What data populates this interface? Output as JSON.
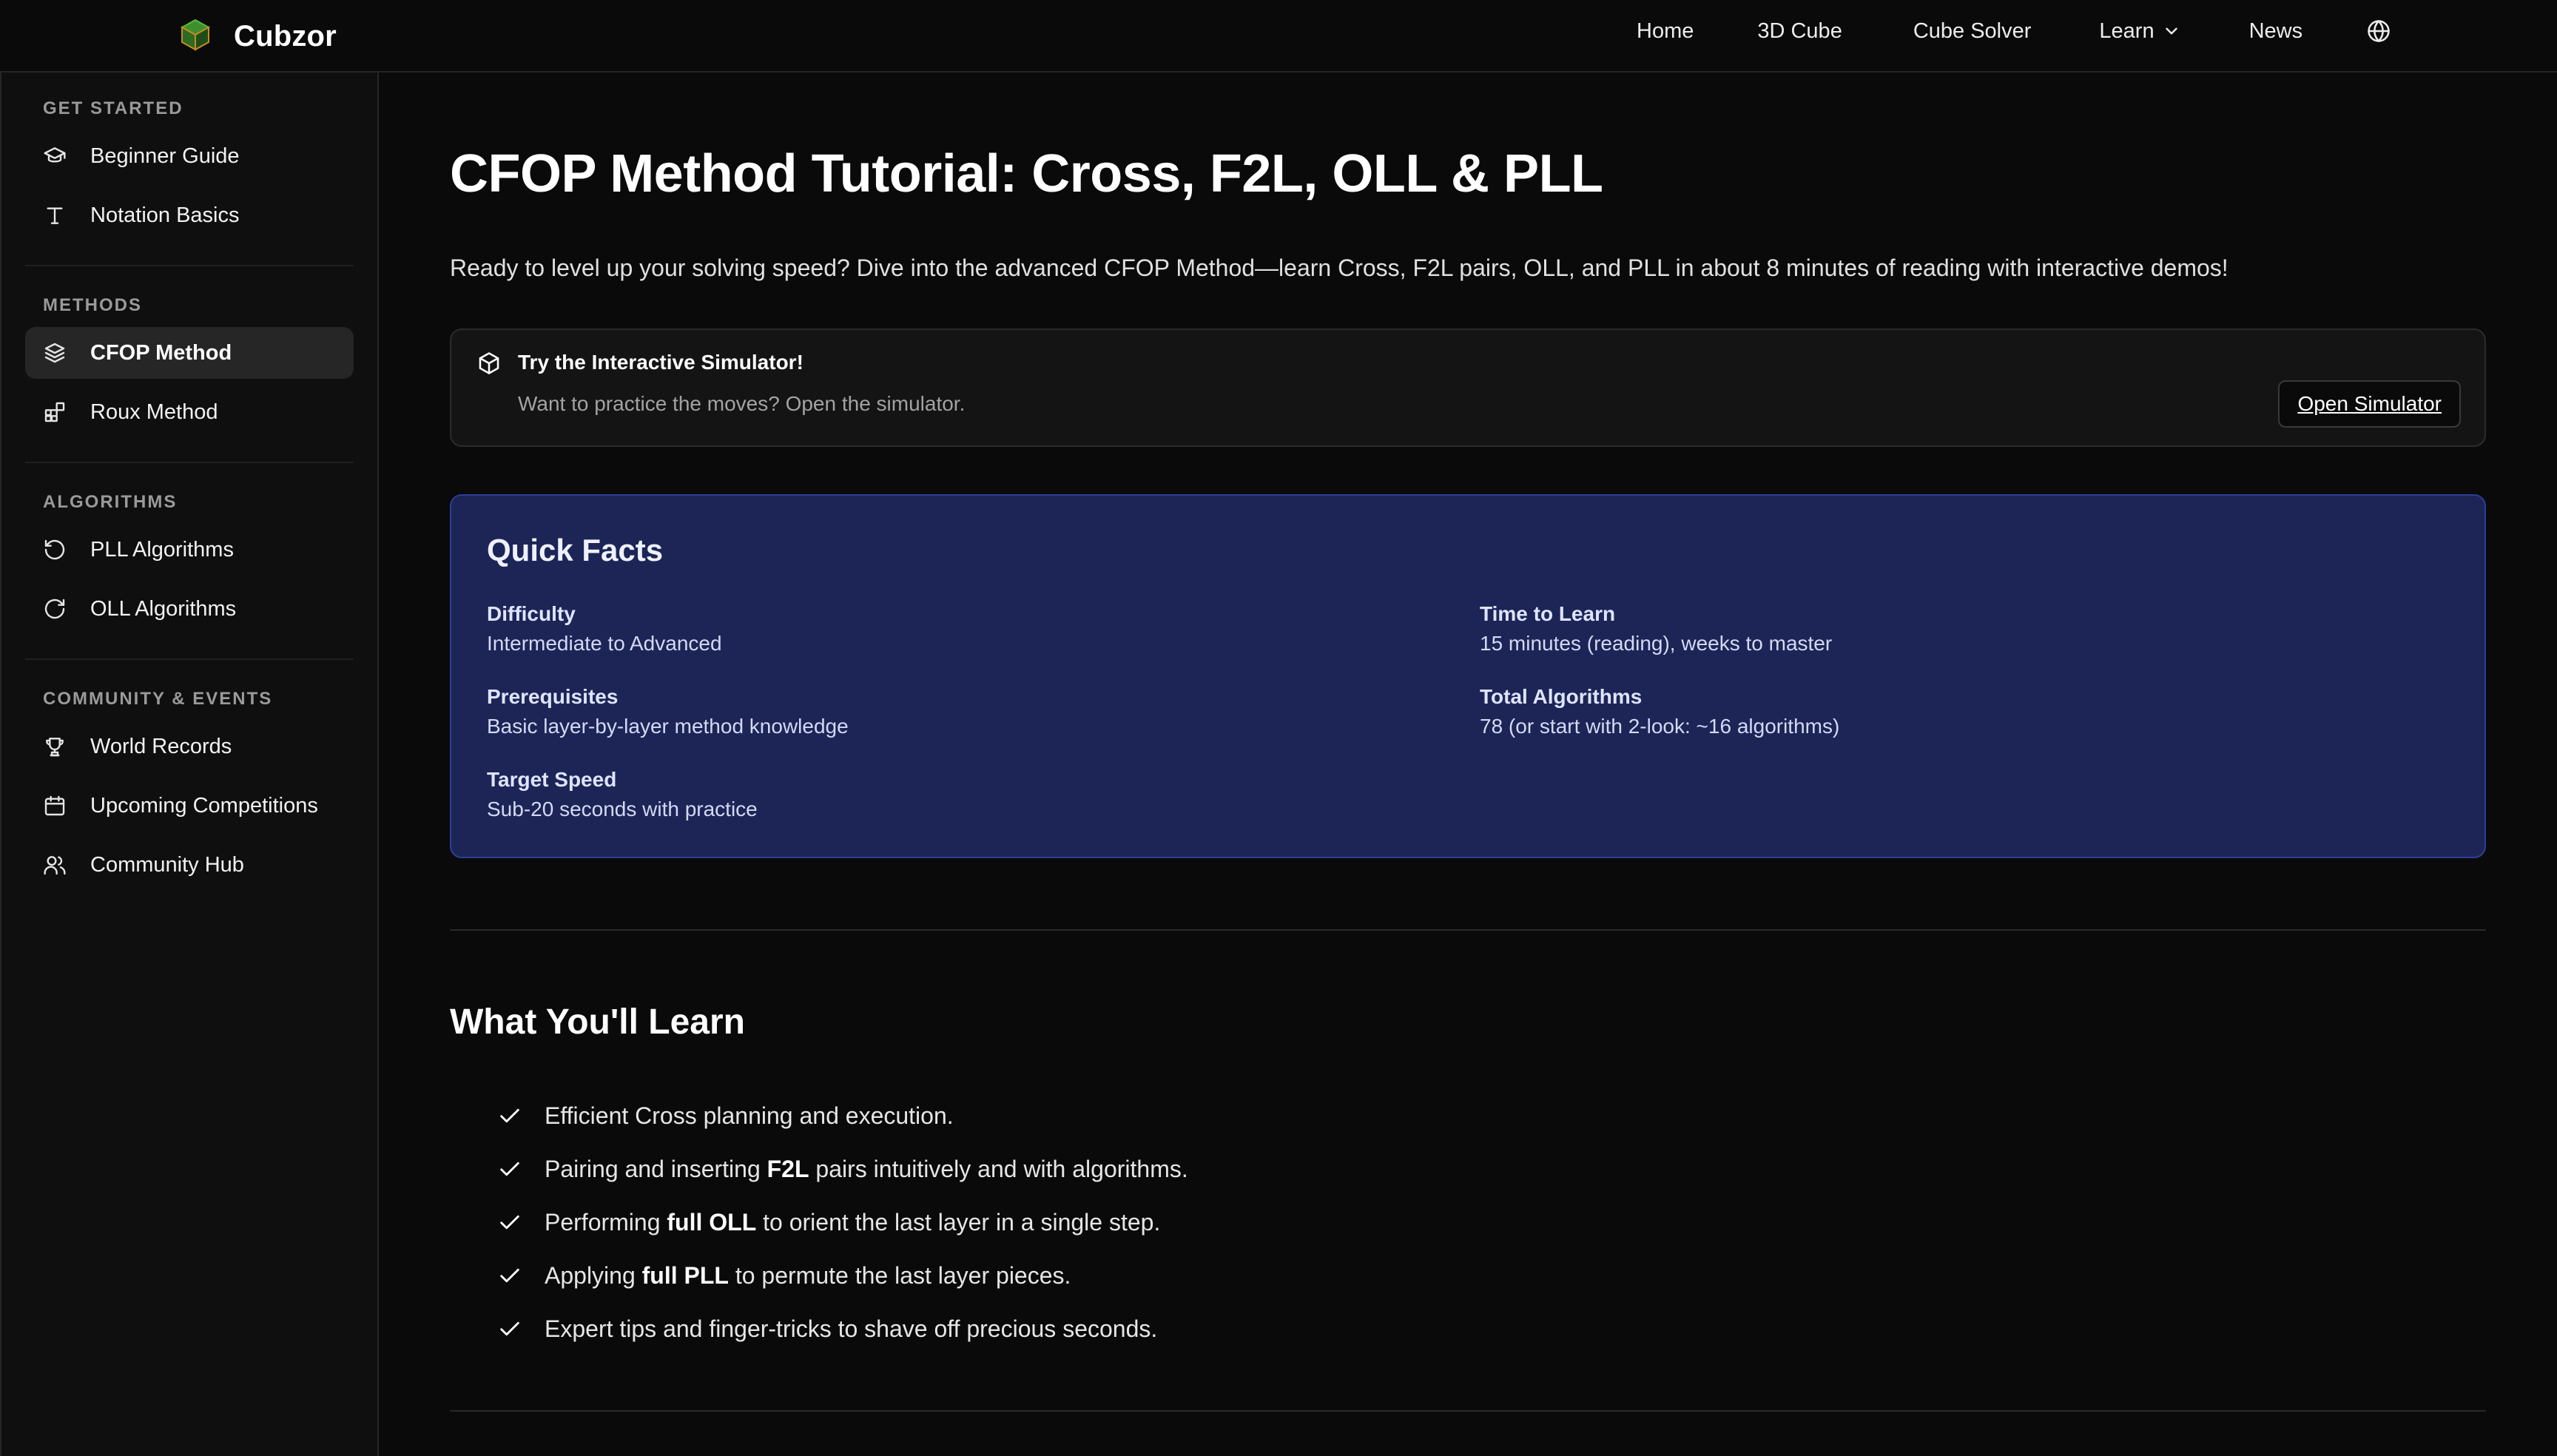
{
  "brand": {
    "name": "Cubzor",
    "logo_icon": "cube-logo-icon"
  },
  "nav": {
    "home": "Home",
    "cube": "3D Cube",
    "solver": "Cube Solver",
    "learn": "Learn",
    "news": "News",
    "language_icon": "globe-icon"
  },
  "sidebar": {
    "sections": [
      {
        "heading": "GET STARTED",
        "items": [
          {
            "label": "Beginner Guide",
            "icon": "graduation-cap-icon"
          },
          {
            "label": "Notation Basics",
            "icon": "text-type-icon"
          }
        ]
      },
      {
        "heading": "METHODS",
        "items": [
          {
            "label": "CFOP Method",
            "icon": "layers-icon",
            "active": true
          },
          {
            "label": "Roux Method",
            "icon": "blocks-icon"
          }
        ]
      },
      {
        "heading": "ALGORITHMS",
        "items": [
          {
            "label": "PLL Algorithms",
            "icon": "rotate-ccw-icon"
          },
          {
            "label": "OLL Algorithms",
            "icon": "rotate-cw-icon"
          }
        ]
      },
      {
        "heading": "COMMUNITY & EVENTS",
        "items": [
          {
            "label": "World Records",
            "icon": "trophy-icon"
          },
          {
            "label": "Upcoming Competitions",
            "icon": "calendar-icon"
          },
          {
            "label": "Community Hub",
            "icon": "users-icon"
          }
        ]
      }
    ]
  },
  "main": {
    "title": "CFOP Method Tutorial: Cross, F2L, OLL & PLL",
    "intro": "Ready to level up your solving speed? Dive into the advanced CFOP Method—learn Cross, F2L pairs, OLL, and PLL in about 8 minutes of reading with interactive demos!",
    "simulator": {
      "title": "Try the Interactive Simulator!",
      "description": "Want to practice the moves? Open the simulator.",
      "button": "Open Simulator"
    },
    "quick_facts": {
      "title": "Quick Facts",
      "difficulty_label": "Difficulty",
      "difficulty_value": "Intermediate to Advanced",
      "time_label": "Time to Learn",
      "time_value": "15 minutes (reading), weeks to master",
      "prereq_label": "Prerequisites",
      "prereq_value": "Basic layer-by-layer method knowledge",
      "total_label": "Total Algorithms",
      "total_value": "78 (or start with 2-look: ~16 algorithms)",
      "speed_label": "Target Speed",
      "speed_value": "Sub-20 seconds with practice"
    },
    "learn_section": {
      "title": "What You'll Learn",
      "items": [
        {
          "pre": "Efficient Cross planning and execution.",
          "bold": "",
          "post": ""
        },
        {
          "pre": "Pairing and inserting ",
          "bold": "F2L",
          "post": " pairs intuitively and with algorithms."
        },
        {
          "pre": "Performing ",
          "bold": "full OLL",
          "post": " to orient the last layer in a single step."
        },
        {
          "pre": "Applying ",
          "bold": "full PLL",
          "post": " to permute the last layer pieces."
        },
        {
          "pre": "Expert tips and finger-tricks to shave off precious seconds.",
          "bold": "",
          "post": ""
        }
      ]
    }
  },
  "colors": {
    "background": "#0a0a0a",
    "sidebar": "#0f0f0f",
    "facts_bg": "#1c2556",
    "facts_border": "#2e3d97",
    "active_item": "#262626"
  }
}
